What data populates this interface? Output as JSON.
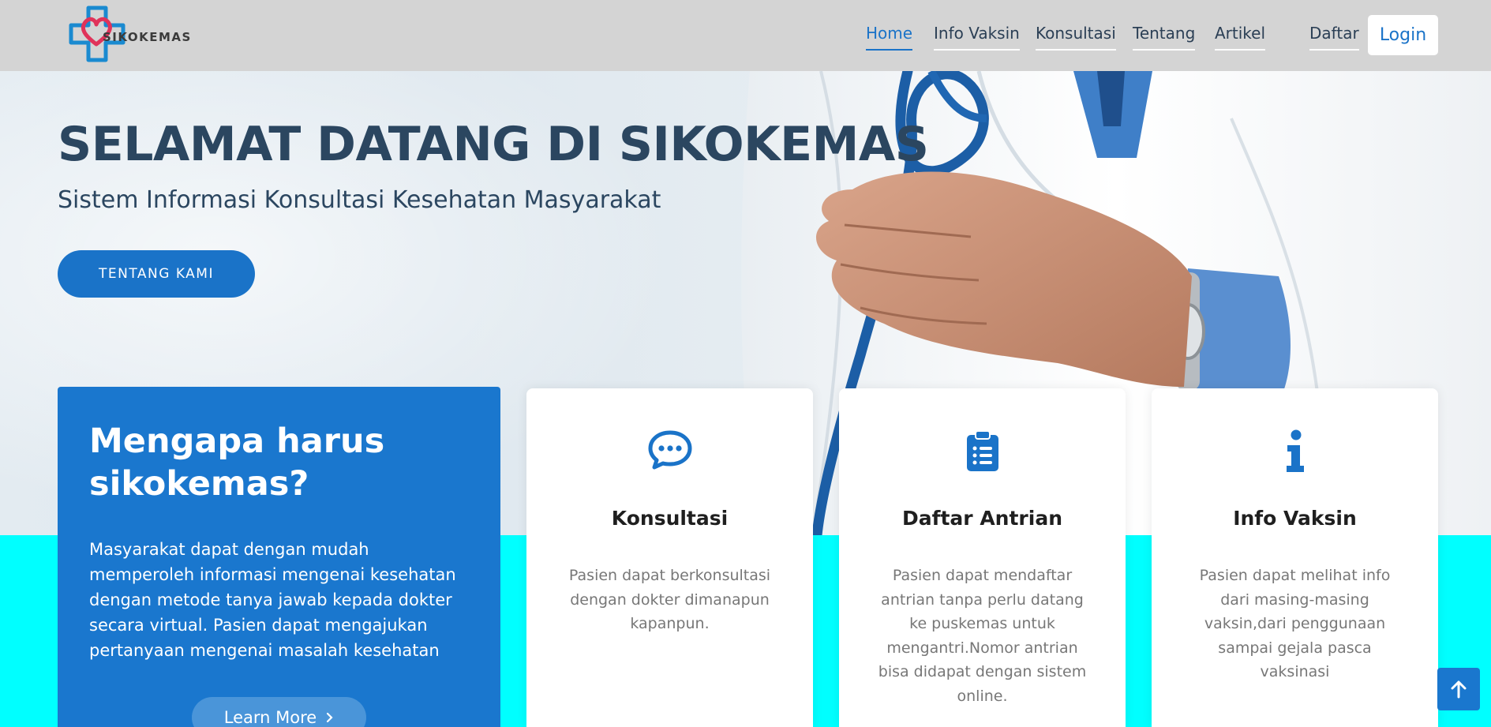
{
  "brand": {
    "name": "SIKOKEMAS"
  },
  "nav": {
    "items": [
      {
        "label": "Home",
        "active": true
      },
      {
        "label": "Info Vaksin",
        "active": false
      },
      {
        "label": "Konsultasi",
        "active": false
      },
      {
        "label": "Tentang",
        "active": false
      },
      {
        "label": "Artikel",
        "active": false
      },
      {
        "label": "Daftar",
        "active": false
      }
    ],
    "login_label": "Login"
  },
  "hero": {
    "title": "SELAMAT DATANG DI SIKOKEMAS",
    "subtitle": "Sistem Informasi Konsultasi Kesehatan Masyarakat",
    "button_label": "TENTANG KAMI"
  },
  "why": {
    "title": "Mengapa harus sikokemas?",
    "text": "Masyarakat dapat dengan mudah memperoleh informasi mengenai kesehatan dengan metode tanya jawab kepada dokter secara virtual. Pasien dapat mengajukan pertanyaan mengenai masalah kesehatan",
    "button_label": "Learn More",
    "button_icon": "chevron-right-icon"
  },
  "cards": [
    {
      "icon": "chat-icon",
      "title": "Konsultasi",
      "text": "Pasien dapat berkonsultasi dengan dokter dimanapun kapanpun."
    },
    {
      "icon": "clipboard-list-icon",
      "title": "Daftar Antrian",
      "text": "Pasien dapat mendaftar antrian tanpa perlu datang ke puskemas untuk mengantri.Nomor antrian bisa didapat dengan sistem online."
    },
    {
      "icon": "info-icon",
      "title": "Info Vaksin",
      "text": "Pasien dapat melihat info dari masing-masing vaksin,dari penggunaan sampai gejala pasca vaksinasi"
    }
  ],
  "colors": {
    "header_bg": "#d4d4d4",
    "accent": "#1a73c8",
    "hero_text": "#2b4660",
    "band": "#00ffff"
  }
}
